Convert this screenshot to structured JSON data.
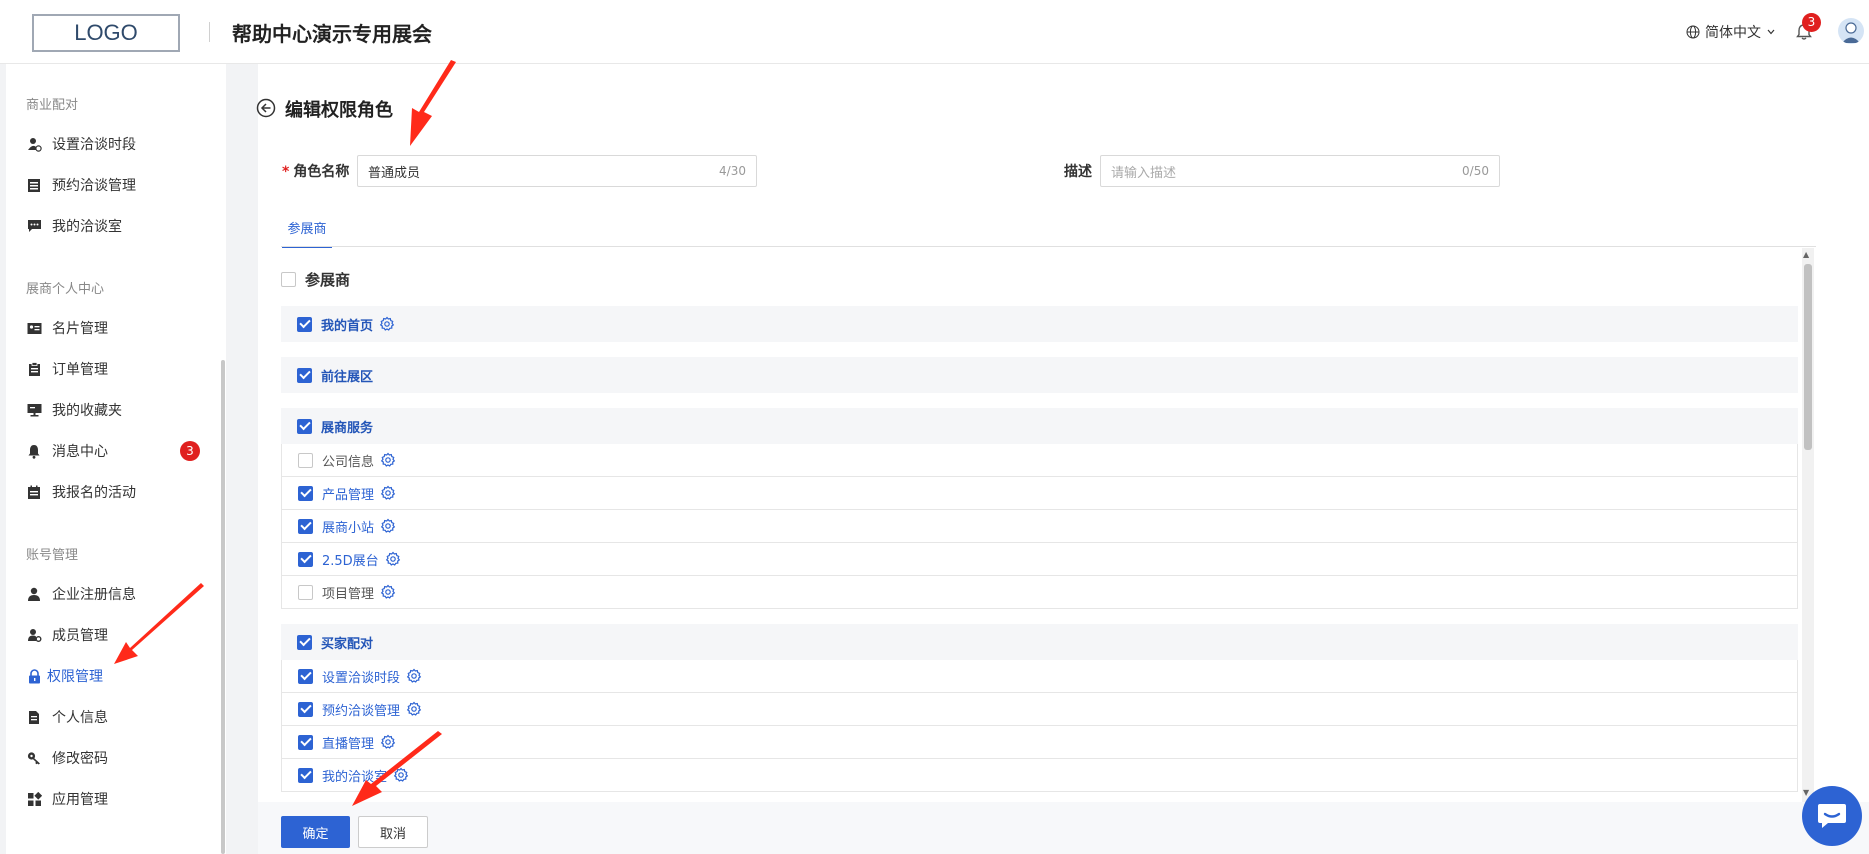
{
  "header": {
    "logo": "LOGO",
    "site_title": "帮助中心演示专用展会",
    "language": "简体中文",
    "notification_count": "3"
  },
  "sidebar": {
    "groups": [
      {
        "title": "商业配对",
        "items": [
          {
            "label": "设置洽谈时段",
            "icon": "user-clock-icon"
          },
          {
            "label": "预约洽谈管理",
            "icon": "clipboard-icon"
          },
          {
            "label": "我的洽谈室",
            "icon": "chat-icon"
          }
        ]
      },
      {
        "title": "展商个人中心",
        "items": [
          {
            "label": "名片管理",
            "icon": "id-card-icon"
          },
          {
            "label": "订单管理",
            "icon": "order-icon"
          },
          {
            "label": "我的收藏夹",
            "icon": "monitor-icon"
          },
          {
            "label": "消息中心",
            "icon": "bell-icon",
            "badge": "3"
          },
          {
            "label": "我报名的活动",
            "icon": "calendar-icon"
          }
        ]
      },
      {
        "title": "账号管理",
        "items": [
          {
            "label": "企业注册信息",
            "icon": "user-icon"
          },
          {
            "label": "成员管理",
            "icon": "user-gear-icon"
          },
          {
            "label": "权限管理",
            "icon": "lock-icon",
            "active": true
          },
          {
            "label": "个人信息",
            "icon": "document-icon"
          },
          {
            "label": "修改密码",
            "icon": "key-icon"
          },
          {
            "label": "应用管理",
            "icon": "apps-icon"
          }
        ]
      }
    ]
  },
  "page": {
    "title": "编辑权限角色",
    "role_name_label": "角色名称",
    "role_name_value": "普通成员",
    "role_name_count": "4/30",
    "desc_label": "描述",
    "desc_placeholder": "请输入描述",
    "desc_count": "0/50",
    "tab": "参展商"
  },
  "permissions": {
    "root_label": "参展商",
    "root_checked": false,
    "rows": [
      {
        "label": "我的首页",
        "type": "section",
        "checked": true,
        "gear": true
      },
      {
        "label": "前往展区",
        "type": "section",
        "checked": true,
        "gear": false
      },
      {
        "label": "展商服务",
        "type": "section",
        "checked": true,
        "gear": false
      },
      {
        "label": "公司信息",
        "type": "child",
        "checked": false,
        "gear": true
      },
      {
        "label": "产品管理",
        "type": "child",
        "checked": true,
        "gear": true
      },
      {
        "label": "展商小站",
        "type": "child",
        "checked": true,
        "gear": true
      },
      {
        "label": "2.5D展台",
        "type": "child",
        "checked": true,
        "gear": true
      },
      {
        "label": "项目管理",
        "type": "child",
        "checked": false,
        "gear": true
      },
      {
        "label": "买家配对",
        "type": "section",
        "checked": true,
        "gear": false
      },
      {
        "label": "设置洽谈时段",
        "type": "child",
        "checked": true,
        "gear": true
      },
      {
        "label": "预约洽谈管理",
        "type": "child",
        "checked": true,
        "gear": true
      },
      {
        "label": "直播管理",
        "type": "child",
        "checked": true,
        "gear": true
      },
      {
        "label": "我的洽谈室",
        "type": "child",
        "checked": true,
        "gear": true
      }
    ]
  },
  "footer": {
    "ok_label": "确定",
    "cancel_label": "取消"
  },
  "colors": {
    "primary": "#2d63d3",
    "badge": "#e0201f",
    "annotation_arrow": "#ff2a1a"
  }
}
